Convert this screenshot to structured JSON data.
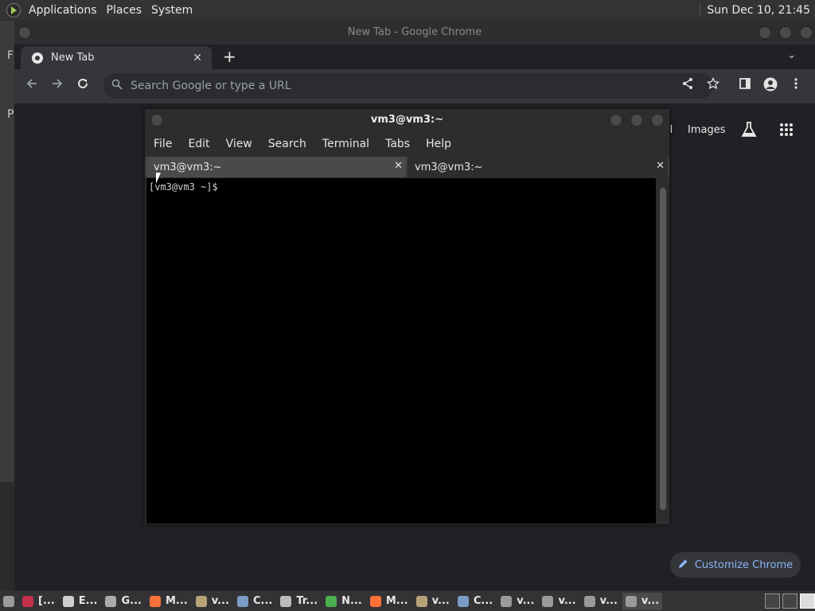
{
  "top_panel": {
    "menus": [
      "Applications",
      "Places",
      "System"
    ],
    "clock": "Sun Dec 10, 21:45"
  },
  "background_window": {
    "letters": [
      "F",
      "P"
    ]
  },
  "chrome": {
    "window_title": "New Tab - Google Chrome",
    "tab_title": "New Tab",
    "tab_close": "✕",
    "new_tab": "+",
    "tab_menu": "⌄",
    "omnibox_placeholder": "Search Google or type a URL",
    "ntp": {
      "gmail_fragment": "il",
      "images_link": "Images",
      "customize_label": "Customize Chrome"
    }
  },
  "terminal": {
    "window_title": "vm3@vm3:~",
    "menus": [
      "File",
      "Edit",
      "View",
      "Search",
      "Terminal",
      "Tabs",
      "Help"
    ],
    "tabs": [
      {
        "label": "vm3@vm3:~",
        "close": "✕"
      },
      {
        "label": "vm3@vm3:~",
        "close": "✕"
      }
    ],
    "prompt": "[vm3@vm3 ~]$"
  },
  "taskbar": {
    "tasks": [
      {
        "label": "[...",
        "icon_color": "#c4314b"
      },
      {
        "label": "E...",
        "icon_color": "#cfcfcf"
      },
      {
        "label": "G...",
        "icon_color": "#aaaaaa"
      },
      {
        "label": "M...",
        "icon_color": "#ff7139"
      },
      {
        "label": "v...",
        "icon_color": "#b8a27a"
      },
      {
        "label": "C...",
        "icon_color": "#7a9cc6"
      },
      {
        "label": "Tr...",
        "icon_color": "#bbbbbb"
      },
      {
        "label": "N...",
        "icon_color": "#4caf50"
      },
      {
        "label": "M...",
        "icon_color": "#ff7139"
      },
      {
        "label": "v...",
        "icon_color": "#b8a27a"
      },
      {
        "label": "C...",
        "icon_color": "#7a9cc6"
      },
      {
        "label": "v...",
        "icon_color": "#9a9a9a"
      },
      {
        "label": "v...",
        "icon_color": "#9a9a9a"
      },
      {
        "label": "v...",
        "icon_color": "#9a9a9a"
      },
      {
        "label": "v...",
        "icon_color": "#9a9a9a"
      }
    ]
  }
}
